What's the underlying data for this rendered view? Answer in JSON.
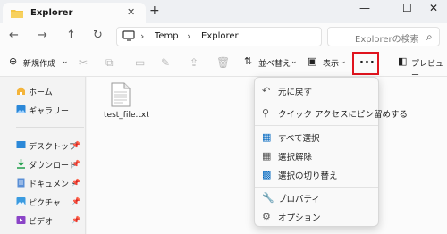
{
  "window": {
    "tab_title": "Explorer",
    "minimize_glyph": "—",
    "maximize_glyph": "☐",
    "close_glyph": "✕"
  },
  "nav": {
    "breadcrumb": [
      "Temp",
      "Explorer"
    ],
    "search_placeholder": "Explorerの検索"
  },
  "commands": {
    "new_label": "新規作成",
    "sort_label": "並べ替え",
    "view_label": "表示",
    "more_label": "···",
    "preview_label": "プレビュー"
  },
  "sidebar": {
    "quick": [
      {
        "label": "ホーム",
        "icon": "home-icon"
      },
      {
        "label": "ギャラリー",
        "icon": "gallery-icon"
      }
    ],
    "pinned": [
      {
        "label": "デスクトップ",
        "icon": "desktop-icon"
      },
      {
        "label": "ダウンロード",
        "icon": "download-icon"
      },
      {
        "label": "ドキュメント",
        "icon": "documents-icon"
      },
      {
        "label": "ピクチャ",
        "icon": "pictures-icon"
      },
      {
        "label": "ビデオ",
        "icon": "videos-icon"
      }
    ]
  },
  "files": [
    {
      "name": "test_file.txt"
    }
  ],
  "menu": {
    "items": [
      {
        "label": "元に戻す",
        "icon": "undo-icon"
      },
      {
        "label": "クイック アクセスにピン留めする",
        "icon": "pin-icon"
      },
      {
        "label": "すべて選択",
        "icon": "select-all-icon"
      },
      {
        "label": "選択解除",
        "icon": "select-none-icon"
      },
      {
        "label": "選択の切り替え",
        "icon": "invert-selection-icon"
      },
      {
        "label": "プロパティ",
        "icon": "properties-icon"
      },
      {
        "label": "オプション",
        "icon": "options-icon"
      }
    ]
  },
  "colors": {
    "highlight_border": "#e0141e",
    "folder": "#f4c542",
    "accent": "#0067c0"
  }
}
